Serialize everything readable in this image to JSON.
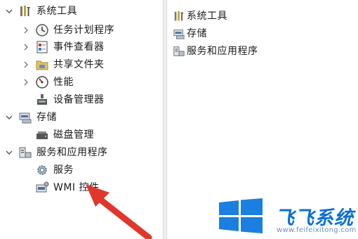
{
  "left_tree": {
    "items": [
      {
        "label": "系统工具",
        "icon": "system-tools-icon",
        "expanded": true
      },
      {
        "label": "任务计划程序",
        "icon": "task-scheduler-icon",
        "expanded": false
      },
      {
        "label": "事件查看器",
        "icon": "event-viewer-icon",
        "expanded": false
      },
      {
        "label": "共享文件夹",
        "icon": "shared-folders-icon",
        "expanded": false
      },
      {
        "label": "性能",
        "icon": "performance-icon",
        "expanded": false
      },
      {
        "label": "设备管理器",
        "icon": "device-manager-icon"
      },
      {
        "label": "存储",
        "icon": "storage-icon",
        "expanded": true
      },
      {
        "label": "磁盘管理",
        "icon": "disk-management-icon"
      },
      {
        "label": "服务和应用程序",
        "icon": "services-apps-icon",
        "expanded": true
      },
      {
        "label": "服务",
        "icon": "services-gear-icon"
      },
      {
        "label": "WMI 控件",
        "icon": "wmi-control-icon"
      }
    ]
  },
  "right_list": {
    "items": [
      {
        "label": "系统工具",
        "icon": "system-tools-icon"
      },
      {
        "label": "存储",
        "icon": "storage-icon"
      },
      {
        "label": "服务和应用程序",
        "icon": "services-apps-icon"
      }
    ]
  },
  "annotation": {
    "arrow_color": "#e0372c",
    "arrow_icon": "red-pointer-arrow"
  },
  "watermark": {
    "brand": "飞飞系统",
    "url": "www.feifeixitong.com",
    "brand_color": "#0a6fd6",
    "logo_icon": "windows-logo-icon"
  }
}
